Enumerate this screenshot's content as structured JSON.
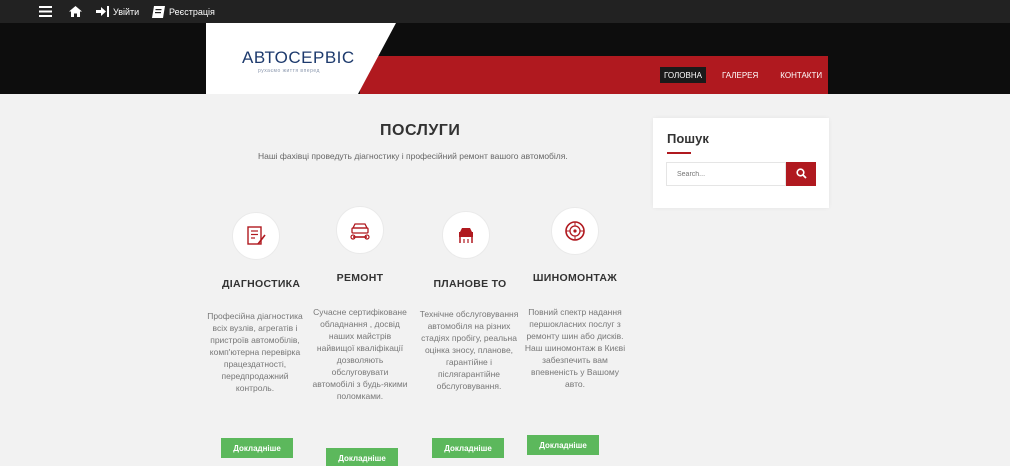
{
  "topbar": {
    "login_label": "Увійти",
    "register_label": "Реєстрація"
  },
  "logo": {
    "title": "АВТОСЕРВІС",
    "tagline": "рухаємо життя вперед"
  },
  "nav": {
    "items": [
      {
        "label": "ГОЛОВНА",
        "active": true
      },
      {
        "label": "ГАЛЕРЕЯ",
        "active": false
      },
      {
        "label": "КОНТАКТИ",
        "active": false
      }
    ]
  },
  "services": {
    "title": "ПОСЛУГИ",
    "subtitle": "Наші фахівці проведуть діагностику і професійний ремонт вашого автомобіля.",
    "items": [
      {
        "icon": "diagnostics-icon",
        "title": "ДІАГНОСТИКА",
        "description": "Професійна діагностика всіх вузлів, агрегатів і пристроїв автомобілів, комп'ютерна перевірка працездатності, передпродажний контроль.",
        "button_label": "Докладніше"
      },
      {
        "icon": "repair-icon",
        "title": "РЕМОНТ",
        "description": "Сучасне сертифіковане обладнання , досвід наших майстрів найвищої кваліфікації дозволяють обслуговувати автомобілі з будь-якими поломками.",
        "button_label": "Докладніше"
      },
      {
        "icon": "car-lift-icon",
        "title": "ПЛАНОВЕ ТО",
        "description": "Технічне обслуговування автомобіля на різних стадіях пробігу, реальна оцінка зносу, планове, гарантійне і післягарантійне обслуговування.",
        "button_label": "Докладніше"
      },
      {
        "icon": "tire-icon",
        "title": "ШИНОМОНТАЖ",
        "description": "Повний спектр надання першокласних послуг з ремонту шин або дисків. Наш шиномонтаж в Києві забезпечить вам впевненість у Вашому авто.",
        "button_label": "Докладніше"
      }
    ]
  },
  "sidebar": {
    "search_title": "Пошук",
    "search_placeholder": "Search..."
  },
  "colors": {
    "accent_red": "#b0191f",
    "button_green": "#5cb85c",
    "logo_blue": "#1d3a6d"
  }
}
